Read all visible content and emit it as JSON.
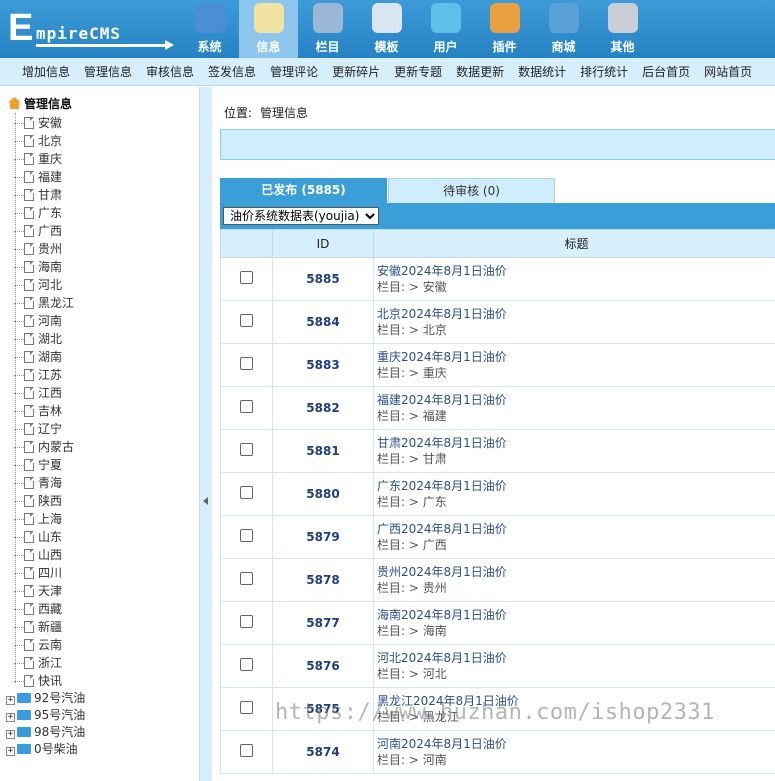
{
  "logo": {
    "first_letter": "E",
    "rest": "mpireCMS"
  },
  "main_nav": [
    {
      "label": "系统",
      "icon": "globe-icon",
      "color": "#4a8fd6"
    },
    {
      "label": "信息",
      "icon": "notepad-pencil-icon",
      "color": "#f3e3a0",
      "active": true
    },
    {
      "label": "栏目",
      "icon": "folder-icon",
      "color": "#9ab8d6"
    },
    {
      "label": "模板",
      "icon": "window-template-icon",
      "color": "#d9e6f1"
    },
    {
      "label": "用户",
      "icon": "user-icon",
      "color": "#5fc0e8"
    },
    {
      "label": "插件",
      "icon": "tools-icon",
      "color": "#e8a040"
    },
    {
      "label": "商城",
      "icon": "card-icon",
      "color": "#5aa0d8"
    },
    {
      "label": "其他",
      "icon": "gear-icon",
      "color": "#c8ced6"
    }
  ],
  "sub_nav": [
    "增加信息",
    "管理信息",
    "审核信息",
    "签发信息",
    "管理评论",
    "更新碎片",
    "更新专题",
    "数据更新",
    "数据统计",
    "排行统计",
    "后台首页",
    "网站首页"
  ],
  "tree": {
    "root": "管理信息",
    "leaves": [
      "安徽",
      "北京",
      "重庆",
      "福建",
      "甘肃",
      "广东",
      "广西",
      "贵州",
      "海南",
      "河北",
      "黑龙江",
      "河南",
      "湖北",
      "湖南",
      "江苏",
      "江西",
      "吉林",
      "辽宁",
      "内蒙古",
      "宁夏",
      "青海",
      "陕西",
      "上海",
      "山东",
      "山西",
      "四川",
      "天津",
      "西藏",
      "新疆",
      "云南",
      "浙江",
      "快讯"
    ],
    "folders": [
      "92号汽油",
      "95号汽油",
      "98号汽油",
      "0号柴油"
    ]
  },
  "breadcrumb": {
    "label": "位置:",
    "current": "管理信息"
  },
  "tabs": {
    "published": "已发布 (5885)",
    "pending": "待审核 (0)"
  },
  "table_select": {
    "value": "油价系统数据表(youjia)"
  },
  "columns": {
    "id": "ID",
    "title": "标题"
  },
  "rows": [
    {
      "id": "5885",
      "title": "安徽2024年8月1日油价",
      "category": "栏目: > 安徽"
    },
    {
      "id": "5884",
      "title": "北京2024年8月1日油价",
      "category": "栏目: > 北京"
    },
    {
      "id": "5883",
      "title": "重庆2024年8月1日油价",
      "category": "栏目: > 重庆"
    },
    {
      "id": "5882",
      "title": "福建2024年8月1日油价",
      "category": "栏目: > 福建"
    },
    {
      "id": "5881",
      "title": "甘肃2024年8月1日油价",
      "category": "栏目: > 甘肃"
    },
    {
      "id": "5880",
      "title": "广东2024年8月1日油价",
      "category": "栏目: > 广东"
    },
    {
      "id": "5879",
      "title": "广西2024年8月1日油价",
      "category": "栏目: > 广西"
    },
    {
      "id": "5878",
      "title": "贵州2024年8月1日油价",
      "category": "栏目: > 贵州"
    },
    {
      "id": "5877",
      "title": "海南2024年8月1日油价",
      "category": "栏目: > 海南"
    },
    {
      "id": "5876",
      "title": "河北2024年8月1日油价",
      "category": "栏目: > 河北"
    },
    {
      "id": "5875",
      "title": "黑龙江2024年8月1日油价",
      "category": "栏目: > 黑龙江"
    },
    {
      "id": "5874",
      "title": "河南2024年8月1日油价",
      "category": "栏目: > 河南"
    }
  ],
  "watermark": "https://www.huzhan.com/ishop2331"
}
